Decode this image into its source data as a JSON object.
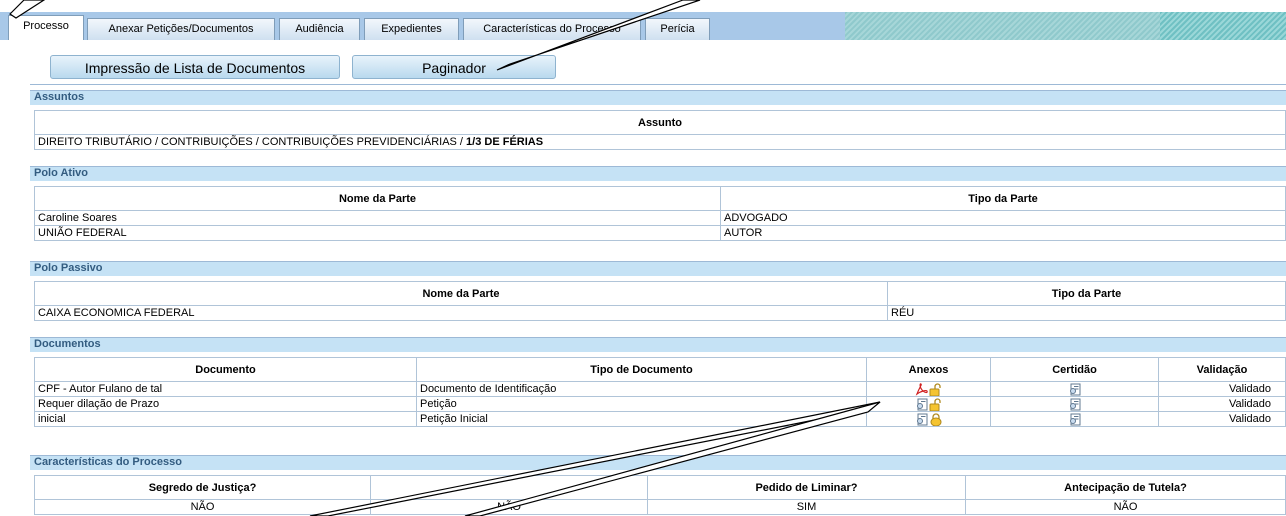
{
  "tabs": [
    {
      "label": "Processo"
    },
    {
      "label": "Anexar Petições/Documentos"
    },
    {
      "label": "Audiência"
    },
    {
      "label": "Expedientes"
    },
    {
      "label": "Características do Processo"
    },
    {
      "label": "Perícia"
    }
  ],
  "buttons": {
    "print_list": "Impressão de Lista de Documentos",
    "paginador": "Paginador"
  },
  "assuntos": {
    "title": "Assuntos",
    "header": "Assunto",
    "row_prefix": "DIREITO TRIBUTÁRIO / CONTRIBUIÇÕES / CONTRIBUIÇÕES PREVIDENCIÁRIAS / ",
    "row_bold": "1/3 DE FÉRIAS"
  },
  "polo_ativo": {
    "title": "Polo Ativo",
    "headers": [
      "Nome da Parte",
      "Tipo da Parte"
    ],
    "rows": [
      {
        "nome": "Caroline Soares",
        "tipo": "ADVOGADO"
      },
      {
        "nome": "UNIÃO FEDERAL",
        "tipo": "AUTOR"
      }
    ]
  },
  "polo_passivo": {
    "title": "Polo Passivo",
    "headers": [
      "Nome da Parte",
      "Tipo da Parte"
    ],
    "rows": [
      {
        "nome": "CAIXA ECONOMICA FEDERAL",
        "tipo": "RÉU"
      }
    ]
  },
  "documentos": {
    "title": "Documentos",
    "headers": [
      "Documento",
      "Tipo de Documento",
      "Anexos",
      "Certidão",
      "Validação"
    ],
    "rows": [
      {
        "documento": "CPF - Autor Fulano de tal",
        "tipo": "Documento de Identificação",
        "anexo_icon": "pdf-icon",
        "lock_icon": "unlocked-icon",
        "validacao": "Validado"
      },
      {
        "documento": "Requer dilação de Prazo",
        "tipo": "Petição",
        "anexo_icon": "document-icon",
        "lock_icon": "unlocked-icon",
        "validacao": "Validado"
      },
      {
        "documento": "inicial",
        "tipo": "Petição Inicial",
        "anexo_icon": "document-icon",
        "lock_icon": "locked-icon",
        "validacao": "Validado"
      }
    ]
  },
  "caracteristicas": {
    "title": "Características do Processo",
    "headers": [
      "Segredo de Justiça?",
      "",
      "Pedido de Liminar?",
      "Antecipação de Tutela?"
    ],
    "values": [
      "NÃO",
      "NÃO",
      "SIM",
      "NÃO"
    ]
  },
  "colors": {
    "accent": "#c5e2f5",
    "header_text": "#335c80",
    "tab_bar": "#a8c8e8"
  }
}
